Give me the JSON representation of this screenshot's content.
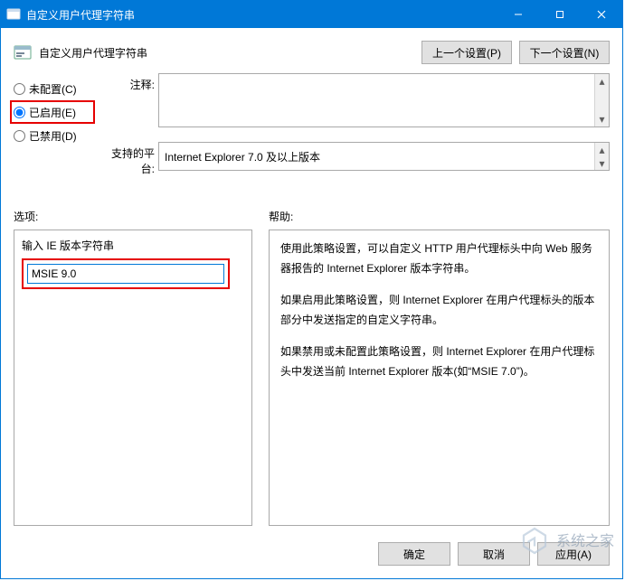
{
  "titlebar": {
    "title": "自定义用户代理字符串"
  },
  "header": {
    "title": "自定义用户代理字符串",
    "prev_btn": "上一个设置(P)",
    "next_btn": "下一个设置(N)"
  },
  "radios": {
    "not_configured": "未配置(C)",
    "enabled": "已启用(E)",
    "disabled": "已禁用(D)",
    "selected": "enabled"
  },
  "fields": {
    "comment_label": "注释:",
    "comment_value": "",
    "platform_label": "支持的平台:",
    "platform_value": "Internet Explorer 7.0 及以上版本"
  },
  "labels": {
    "options": "选项:",
    "help": "帮助:"
  },
  "options_panel": {
    "prompt": "输入 IE 版本字符串",
    "value": "MSIE 9.0"
  },
  "help_panel": {
    "para1": "使用此策略设置，可以自定义 HTTP 用户代理标头中向 Web 服务器报告的 Internet Explorer 版本字符串。",
    "para2": "如果启用此策略设置，则 Internet Explorer 在用户代理标头的版本部分中发送指定的自定义字符串。",
    "para3": "如果禁用或未配置此策略设置，则 Internet Explorer 在用户代理标头中发送当前 Internet Explorer 版本(如“MSIE 7.0”)。"
  },
  "footer": {
    "ok": "确定",
    "cancel": "取消",
    "apply": "应用(A)"
  },
  "watermark": {
    "text": "系统之家"
  }
}
